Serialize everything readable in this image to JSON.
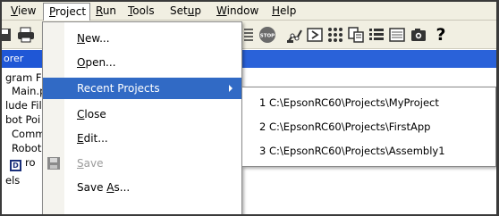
{
  "menubar": {
    "items": [
      "View",
      "Project",
      "Run",
      "Tools",
      "Setup",
      "Window",
      "Help"
    ],
    "underline": [
      "V",
      "P",
      "R",
      "T",
      "u",
      "W",
      "H"
    ]
  },
  "left_panel": {
    "header": "orer",
    "items": [
      "gram F",
      "Main.p",
      "lude Fil",
      "bot Poi",
      "Comm",
      "Robot",
      "ro",
      "els"
    ]
  },
  "project_menu": {
    "items": [
      {
        "label": "New...",
        "mnemonic": "N",
        "state": "normal"
      },
      {
        "label": "Open...",
        "mnemonic": "O",
        "state": "normal"
      },
      {
        "label": "Recent Projects",
        "mnemonic": "",
        "state": "highlighted",
        "has_submenu": true
      },
      {
        "label": "Close",
        "mnemonic": "C",
        "state": "normal"
      },
      {
        "label": "Edit...",
        "mnemonic": "E",
        "state": "normal"
      },
      {
        "label": "Save",
        "mnemonic": "S",
        "state": "disabled",
        "icon": "save-disk-icon"
      },
      {
        "label": "Save As...",
        "mnemonic": "A",
        "state": "normal"
      }
    ]
  },
  "recent_projects": [
    "1 C:\\EpsonRC60\\Projects\\MyProject",
    "2 C:\\EpsonRC60\\Projects\\FirstApp",
    "3 C:\\EpsonRC60\\Projects\\Assembly1"
  ],
  "toolbar": {
    "icons": [
      "save-icon",
      "print-icon",
      "indent-icon",
      "stop-icon",
      "robot-arm-icon",
      "run-window-icon",
      "io-monitor-icon",
      "jog-teach-icon",
      "command-window-icon",
      "point-editor-icon",
      "camera-icon",
      "help-icon"
    ],
    "stop_label": "STOP",
    "help_label": "?"
  },
  "colors": {
    "menu_highlight": "#316ac5",
    "title_blue": "#1f57d6",
    "menubar_bg": "#f1efe2",
    "disabled_text": "#9b9b9b"
  }
}
